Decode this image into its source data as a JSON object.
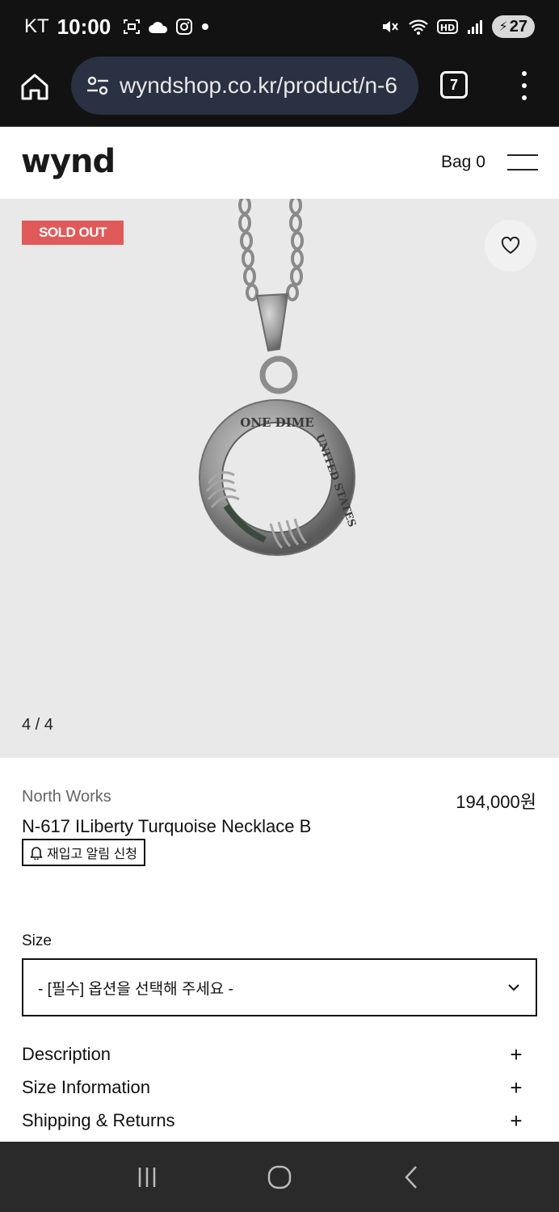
{
  "status_bar": {
    "carrier": "KT",
    "time": "10:00",
    "battery": "27"
  },
  "browser": {
    "url": "wyndshop.co.kr/product/n-6",
    "tab_count": "7"
  },
  "site": {
    "logo": "wynd",
    "bag_label": "Bag 0"
  },
  "gallery": {
    "badge": "SOLD OUT",
    "counter": "4 / 4"
  },
  "product": {
    "brand": "North Works",
    "price": "194,000원",
    "name": "N-617 ILiberty Turquoise Necklace B",
    "restock_label": "재입고 알림 신청"
  },
  "options": {
    "size_label": "Size",
    "size_placeholder": "- [필수] 옵션을 선택해 주세요 -"
  },
  "accordion": [
    {
      "label": "Description"
    },
    {
      "label": "Size Information"
    },
    {
      "label": "Shipping & Returns"
    }
  ],
  "colors": {
    "sold_out_badge": "#e05a5a",
    "status_bar_bg": "#121212",
    "url_pill_bg": "#2a3142",
    "gallery_bg": "#e9e9e9",
    "nav_bar_bg": "#2a2a2a"
  },
  "icons": {
    "status_left": [
      "screenshot-icon",
      "cloud-icon",
      "instagram-icon",
      "dot-icon"
    ],
    "status_right": [
      "mute-icon",
      "wifi-icon",
      "hd-icon",
      "signal-icon"
    ],
    "browser": [
      "home-icon",
      "tune-icon",
      "tabs-icon",
      "more-vert-icon"
    ],
    "nav": [
      "recents-icon",
      "home-circle-icon",
      "back-icon"
    ]
  }
}
